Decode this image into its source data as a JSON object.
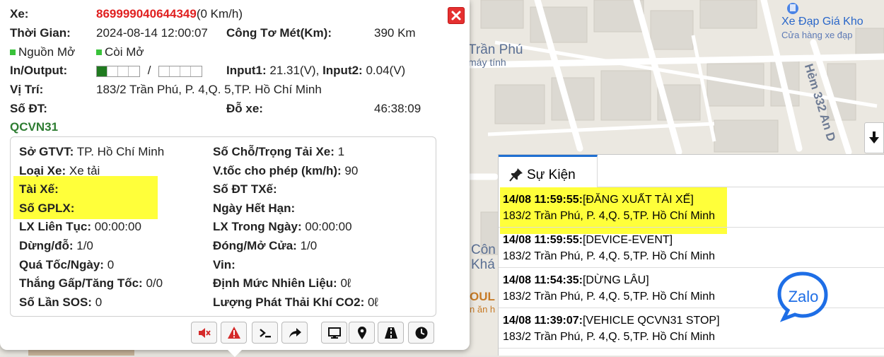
{
  "map": {
    "street_label": "Trần Phú",
    "street_sub": "máy tính",
    "poi_title": "Xe Đạp Giá Kho",
    "poi_sub": "Cửa hàng xe đạp",
    "road_label": "Hẻm 332 An D",
    "partial_1": "Côn",
    "partial_2": "Khá",
    "partial_3": "OUL",
    "partial_4": "n ăn h"
  },
  "info": {
    "vehicle_label": "Xe:",
    "vehicle_id": "869999040644349",
    "speed": "(0 Km/h)",
    "time_label": "Thời Gian:",
    "time_value": "2024-08-14 12:00:07",
    "odometer_label": "Công Tơ Mét(Km):",
    "odometer_value": "390 Km",
    "power_label": "Nguồn Mở",
    "horn_label": "Còi Mở",
    "io_label": "In/Output:",
    "io_separator": "/",
    "input1_label": "Input1:",
    "input1_value": "21.31(V),",
    "input2_label": "Input2:",
    "input2_value": "0.04(V)",
    "location_label": "Vị Trí:",
    "location_value": "183/2 Trần Phú, P. 4,Q. 5,TP. Hồ Chí Minh",
    "phone_label": "Số ĐT:",
    "parking_label": "Đỗ xe:",
    "parking_value": "46:38:09",
    "section_title": "QCVN31"
  },
  "qcvn": {
    "dept_label": "Sở GTVT:",
    "dept_value": "TP. Hồ Chí Minh",
    "seats_label": "Số Chỗ/Trọng Tải Xe:",
    "seats_value": "1",
    "type_label": "Loại Xe:",
    "type_value": "Xe tải",
    "speed_limit_label": "V.tốc cho phép (km/h):",
    "speed_limit_value": "90",
    "driver_label": "Tài Xế:",
    "driver_phone_label": "Số ĐT TXế:",
    "license_label": "Số GPLX:",
    "expiry_label": "Ngày Hết Hạn:",
    "continuous_label": "LX Liên Tục:",
    "continuous_value": "00:00:00",
    "daily_label": "LX Trong Ngày:",
    "daily_value": "00:00:00",
    "stops_label": "Dừng/đỗ:",
    "stops_value": "1/0",
    "door_label": "Đóng/Mở Cửa:",
    "door_value": "1/0",
    "overspeed_label": "Quá Tốc/Ngày:",
    "overspeed_value": "0",
    "vin_label": "Vin:",
    "brake_label": "Thắng Gấp/Tăng Tốc:",
    "brake_value": "0/0",
    "fuel_label": "Định Mức Nhiên Liệu:",
    "fuel_value": "0ℓ",
    "sos_label": "Số Lần SOS:",
    "sos_value": "0",
    "co2_label": "Lượng Phát Thải Khí CO2:",
    "co2_value": "0ℓ"
  },
  "io_state": {
    "inputs": [
      true,
      false,
      false,
      false
    ],
    "outputs": [
      false,
      false,
      false,
      false
    ]
  },
  "toolbar": [
    "mute-icon",
    "warning-icon",
    "terminal-icon",
    "share-icon",
    "monitor-icon",
    "map-pin-icon",
    "road-icon",
    "clock-icon"
  ],
  "events": {
    "tab_label": "Sự Kiện",
    "items": [
      {
        "time": "14/08 11:59:55:",
        "type": "[ĐĂNG XUẤT TÀI XẾ]",
        "address": "183/2 Trần Phú, P. 4,Q. 5,TP. Hồ Chí Minh"
      },
      {
        "time": "14/08 11:59:55:",
        "type": "[DEVICE-EVENT]",
        "address": "183/2 Trần Phú, P. 4,Q. 5,TP. Hồ Chí Minh"
      },
      {
        "time": "14/08 11:54:35:",
        "type": "[DỪNG LÂU]",
        "address": "183/2 Trần Phú, P. 4,Q. 5,TP. Hồ Chí Minh"
      },
      {
        "time": "14/08 11:39:07:",
        "type": "[VEHICLE QCVN31 STOP]",
        "address": "183/2 Trần Phú, P. 4,Q. 5,TP. Hồ Chí Minh"
      }
    ]
  },
  "zalo_label": "Zalo",
  "colors": {
    "plate": "#e02020",
    "highlight": "#ffff3a",
    "accent": "#1f6fd1",
    "qcvn": "#2e7d32",
    "on": "#39c23a"
  }
}
